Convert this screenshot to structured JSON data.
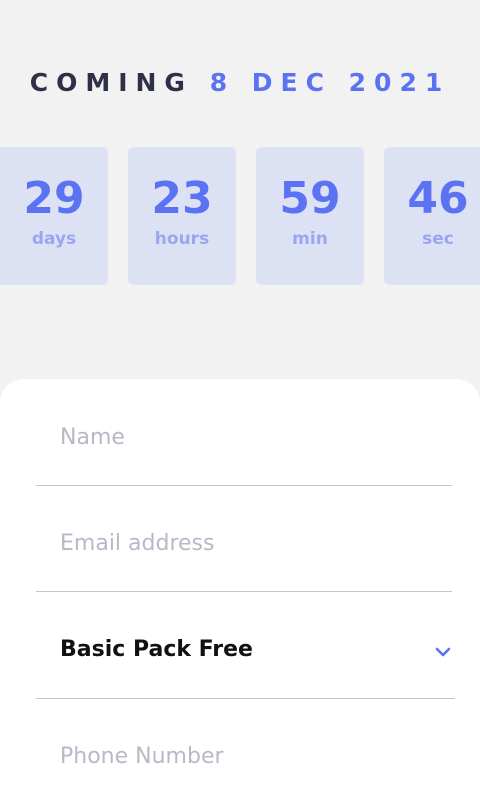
{
  "headline": {
    "prefix": "COMING",
    "date": "8 DEC 2021"
  },
  "countdown": [
    {
      "value": "29",
      "unit": "days"
    },
    {
      "value": "23",
      "unit": "hours"
    },
    {
      "value": "59",
      "unit": "min"
    },
    {
      "value": "46",
      "unit": "sec"
    }
  ],
  "form": {
    "name_placeholder": "Name",
    "email_placeholder": "Email address",
    "plan_selected": "Basic Pack Free",
    "phone_placeholder": "Phone Number"
  },
  "icons": {
    "plan_dropdown": "chevron-down-icon"
  },
  "colors": {
    "accent": "#5b72f2",
    "dark_text": "#2d3047",
    "box_background": "#dde1f4",
    "unit_text": "#9aa6ef",
    "page_background": "#f2f2f2"
  }
}
